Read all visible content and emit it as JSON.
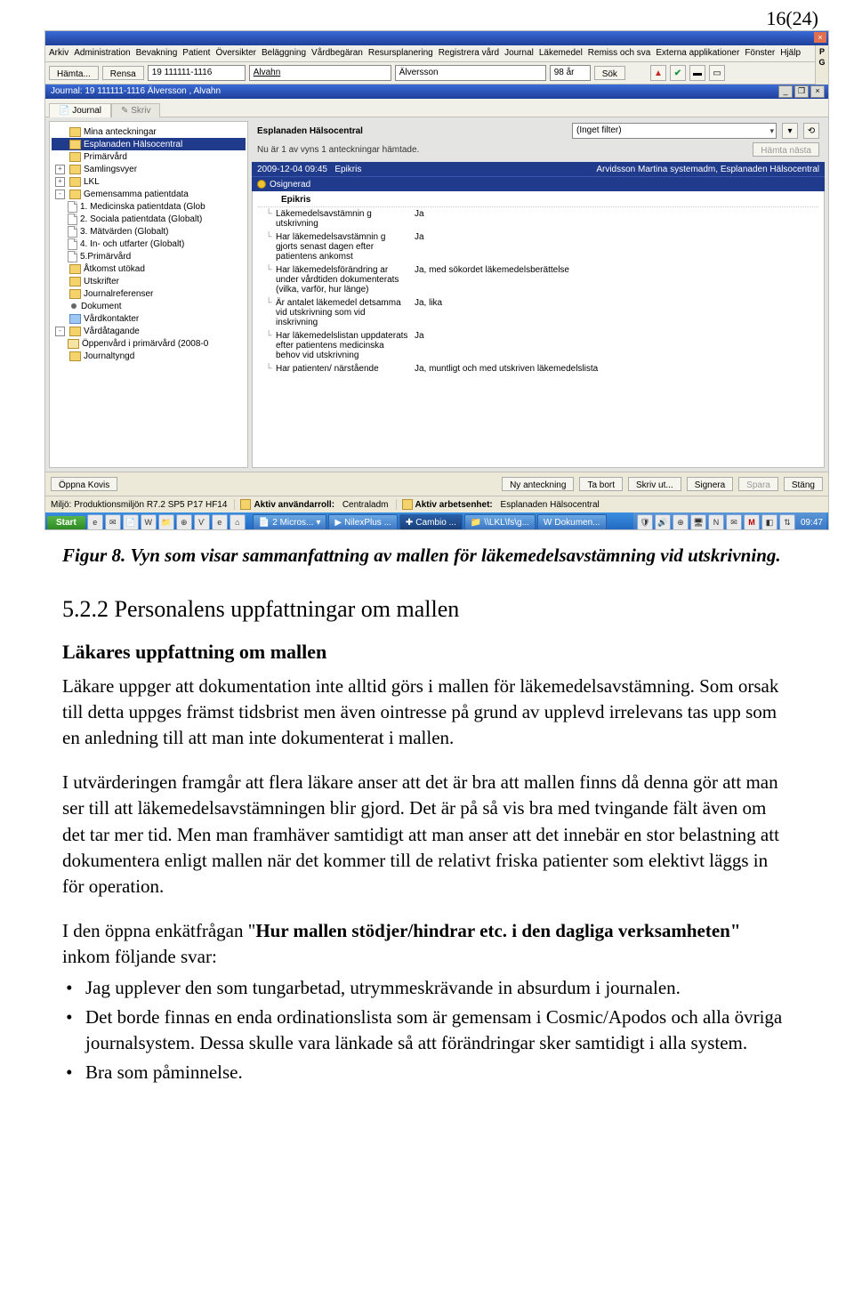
{
  "pagenum": "16(24)",
  "app": {
    "menus": [
      "Arkiv",
      "Administration",
      "Bevakning",
      "Patient",
      "Översikter",
      "Beläggning",
      "Vårdbegäran",
      "Resursplanering",
      "Registrera vård",
      "Journal",
      "Läkemedel",
      "Remiss och sva",
      "Externa applikationer",
      "Fönster",
      "Hjälp"
    ],
    "toolbar": {
      "hamta": "Hämta...",
      "rensa": "Rensa",
      "pnr": "19 111111-1116",
      "fname": "Alvahn",
      "lname": "Älversson",
      "age": "98 år",
      "sok": "Sök",
      "sidebtns": [
        "P",
        "G"
      ]
    },
    "subTitle": "Journal: 19 111111-1116 Älversson , Alvahn",
    "tabs": {
      "journal": "Journal",
      "skriv": "Skriv"
    },
    "tree": [
      {
        "t": "Mina anteckningar",
        "lvl": 0,
        "ico": "fold"
      },
      {
        "t": "Esplanaden Hälsocentral",
        "lvl": 0,
        "ico": "fold",
        "sel": true
      },
      {
        "t": "Primärvård",
        "lvl": 0,
        "ico": "fold"
      },
      {
        "t": "Samlingsvyer",
        "lvl": 0,
        "ico": "fold",
        "plus": "+"
      },
      {
        "t": "LKL",
        "lvl": 0,
        "ico": "fold",
        "plus": "+"
      },
      {
        "t": "Gemensamma patientdata",
        "lvl": 0,
        "ico": "fold",
        "plus": "-"
      },
      {
        "t": "1. Medicinska patientdata  (Glob",
        "lvl": 1,
        "ico": "page"
      },
      {
        "t": "2. Sociala patientdata  (Globalt)",
        "lvl": 1,
        "ico": "page"
      },
      {
        "t": "3. Mätvärden (Globalt)",
        "lvl": 1,
        "ico": "page"
      },
      {
        "t": "4. In- och utfarter (Globalt)",
        "lvl": 1,
        "ico": "page"
      },
      {
        "t": "5.Primärvård",
        "lvl": 1,
        "ico": "page"
      },
      {
        "t": "Åtkomst utökad",
        "lvl": 0,
        "ico": "fold"
      },
      {
        "t": "Utskrifter",
        "lvl": 0,
        "ico": "fold"
      },
      {
        "t": "Journalreferenser",
        "lvl": 0,
        "ico": "fold"
      },
      {
        "t": "Dokument",
        "lvl": 0,
        "ico": "dot"
      },
      {
        "t": "Vårdkontakter",
        "lvl": 0,
        "ico": "blue"
      },
      {
        "t": "Vårdåtagande",
        "lvl": 0,
        "ico": "fold",
        "plus": "-"
      },
      {
        "t": "Öppenvård i primärvård (2008-0",
        "lvl": 1,
        "ico": "foldopen"
      },
      {
        "t": "Journaltyngd",
        "lvl": 0,
        "ico": "fold"
      }
    ],
    "filter": {
      "title": "Esplanaden Hälsocentral",
      "value": "(Inget filter)",
      "info": "Nu är 1 av vyns 1 anteckningar hämtade.",
      "hamta_nasta": "Hämta nästa"
    },
    "band": {
      "dt": "2009-12-04 09:45",
      "type": "Epikris",
      "author": "Arvidsson Martina systemadm, Esplanaden Hälsocentral",
      "status": "Osignerad"
    },
    "note": {
      "head": "Epikris",
      "rows": [
        {
          "l": "Läkemedelsavstämnin g utskrivning",
          "v": "Ja"
        },
        {
          "l": "Har läkemedelsavstämnin g gjorts senast dagen efter patientens ankomst",
          "v": "Ja"
        },
        {
          "l": "Har läkemedelsförändring ar under vårdtiden dokumenterats (vilka, varför, hur länge)",
          "v": "Ja, med sökordet läkemedelsberättelse"
        },
        {
          "l": "Är antalet läkemedel detsamma vid utskrivning som vid inskrivning",
          "v": "Ja, lika"
        },
        {
          "l": "Har läkemedelslistan uppdaterats efter patientens medicinska behov vid utskrivning",
          "v": "Ja"
        },
        {
          "l": "Har patienten/ närstående",
          "v": "Ja, muntligt och med utskriven läkemedelslista"
        }
      ]
    },
    "bottom": {
      "kovis": "Öppna Kovis",
      "ny": "Ny anteckning",
      "tabort": "Ta bort",
      "skriv": "Skriv ut...",
      "signera": "Signera",
      "spara": "Spara",
      "stang": "Stäng"
    },
    "status": {
      "env": "Miljö: Produktionsmiljön R7.2 SP5 P17 HF14",
      "rolelbl": "Aktiv användarroll:",
      "role": "Centraladm",
      "unitlbl": "Aktiv arbetsenhet:",
      "unit": "Esplanaden Hälsocentral"
    },
    "taskbar": {
      "start": "Start",
      "items": [
        "2 Micros...",
        "NilexPlus ...",
        "Cambio ...",
        "\\\\LKL\\fs\\g...",
        "Dokumen..."
      ],
      "clock": "09:47"
    }
  },
  "doc": {
    "figcap": "Figur 8. Vyn som visar sammanfattning av mallen för läkemedelsavstämning vid utskrivning.",
    "h2": "5.2.2 Personalens uppfattningar om mallen",
    "h3": "Läkares uppfattning om mallen",
    "p1": "Läkare uppger att dokumentation inte alltid görs i mallen för läkemedelsavstämning. Som orsak till detta uppges främst tidsbrist men även ointresse på grund av upplevd irrelevans tas upp som en anledning till att man inte dokumenterat i mallen.",
    "p2": "I utvärderingen framgår att flera läkare anser att det är bra att mallen finns då denna gör att man ser till att läkemedelsavstämningen blir gjord. Det är på så vis bra med tvingande fält även om det tar mer tid. Men man framhäver samtidigt att man anser att det innebär en stor belastning att dokumentera enligt mallen när det kommer till de relativt friska patienter som elektivt läggs in för operation.",
    "p3a": "I den öppna enkätfrågan \"",
    "p3b": "Hur mallen stödjer/hindrar etc. i den dagliga verksamheten\"",
    "p3c": " inkom följande svar:",
    "bullets": [
      "Jag upplever den som tungarbetad, utrymmeskrävande in absurdum i journalen.",
      "Det borde finnas en enda ordinationslista som är gemensam i Cosmic/Apodos och alla övriga journalsystem. Dessa skulle vara länkade så att förändringar sker samtidigt i alla system.",
      "Bra som påminnelse."
    ]
  }
}
